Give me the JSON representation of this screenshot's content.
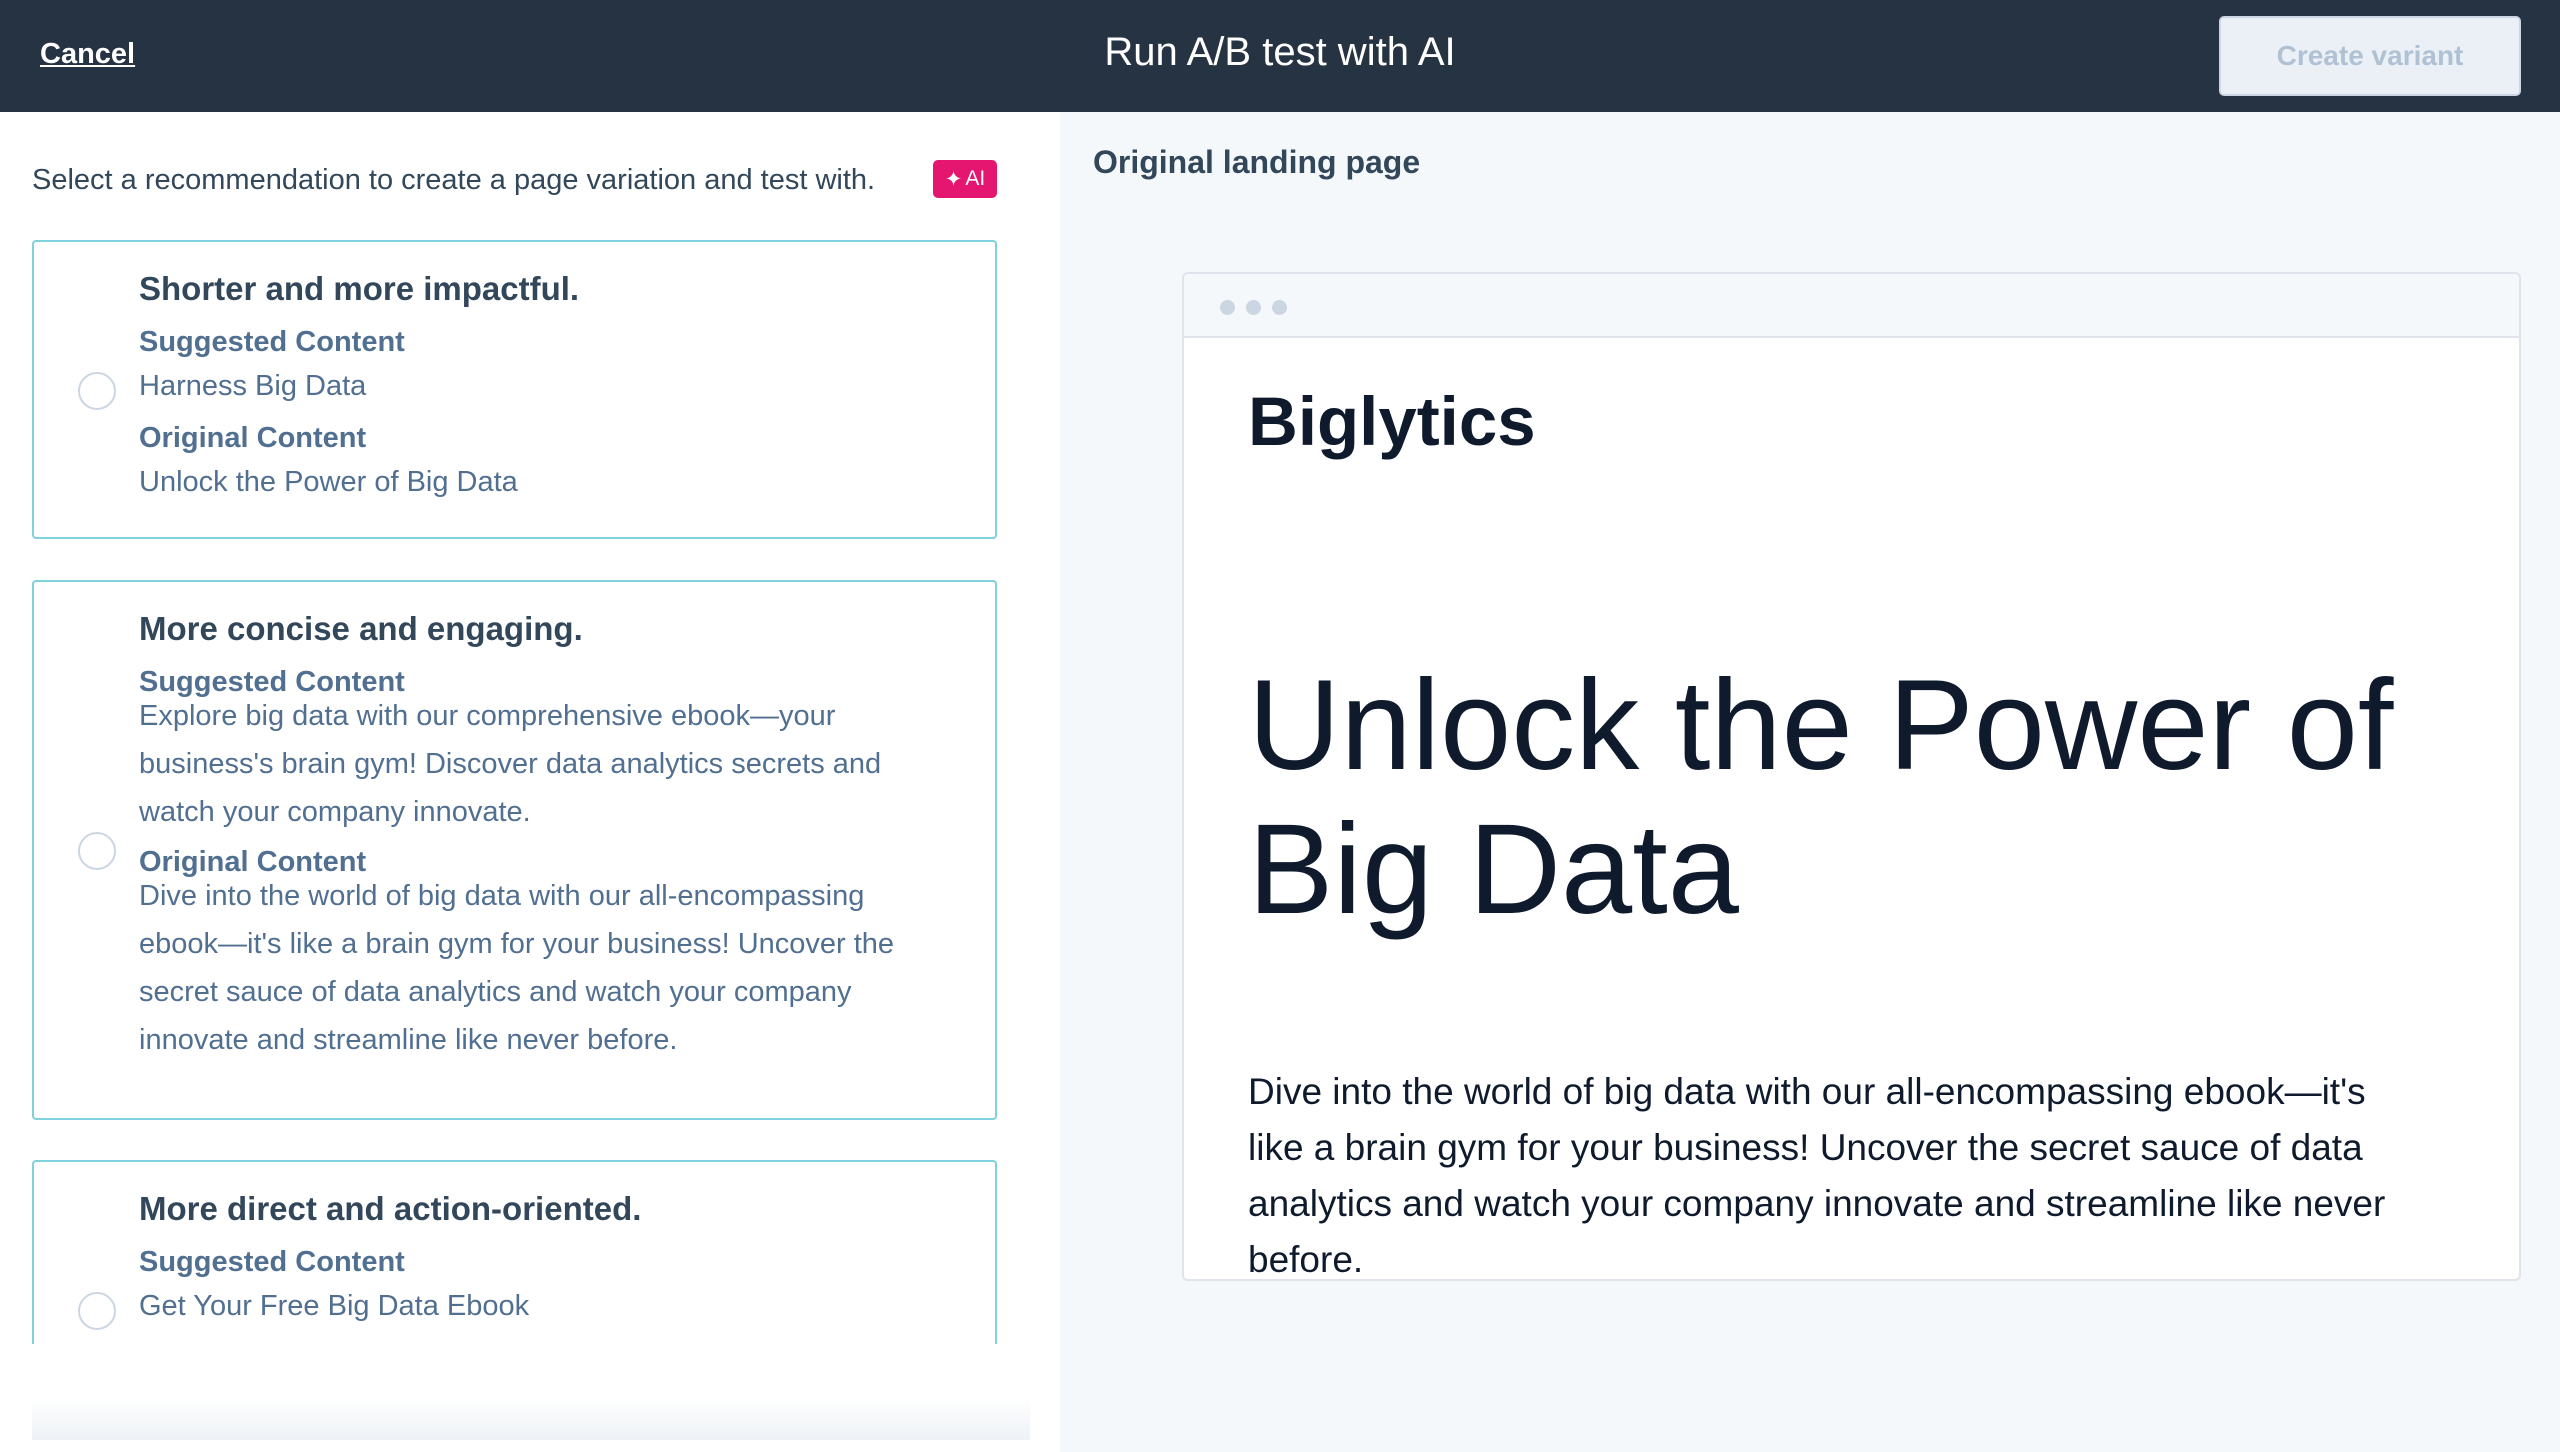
{
  "header": {
    "cancel_label": "Cancel",
    "title": "Run A/B test with AI",
    "create_variant_label": "Create variant"
  },
  "left": {
    "intro": "Select a recommendation to create a page variation and test with.",
    "ai_badge": {
      "icon": "sparkle-icon",
      "glyph": "✦",
      "label": "AI",
      "color": "#e5166f"
    },
    "recommendations": [
      {
        "heading": "Shorter and more impactful.",
        "suggested_label": "Suggested Content",
        "suggested": "Harness Big Data",
        "original_label": "Original Content",
        "original": "Unlock the Power of Big Data"
      },
      {
        "heading": "More concise and engaging.",
        "suggested_label": "Suggested Content",
        "suggested_lines": [
          "Explore big data with our comprehensive ebook—your",
          "business's brain gym! Discover data analytics secrets and",
          "watch your company innovate."
        ],
        "original_label": "Original Content",
        "original_lines": [
          "Dive into the world of big data with our all-encompassing",
          "ebook—it's like a brain gym for your business! Uncover the",
          "secret sauce of data analytics and watch your company",
          "innovate and streamline like never before."
        ]
      },
      {
        "heading": "More direct and action-oriented.",
        "suggested_label": "Suggested Content",
        "suggested": "Get Your Free Big Data Ebook"
      }
    ]
  },
  "preview": {
    "title": "Original landing page",
    "brand": "Biglytics",
    "hero_lines": [
      "Unlock the Power of",
      "Big Data"
    ],
    "body_lines": [
      "Dive into the world of big data with our all-encompassing ebook—it's",
      "like a brain gym for your business! Uncover the secret sauce of data",
      "analytics and watch your company innovate and streamline like never",
      "before."
    ]
  },
  "colors": {
    "header_bg": "#253342",
    "card_border": "#7fd1de",
    "label_text": "#516f90",
    "preview_bg": "#f5f8fa"
  }
}
